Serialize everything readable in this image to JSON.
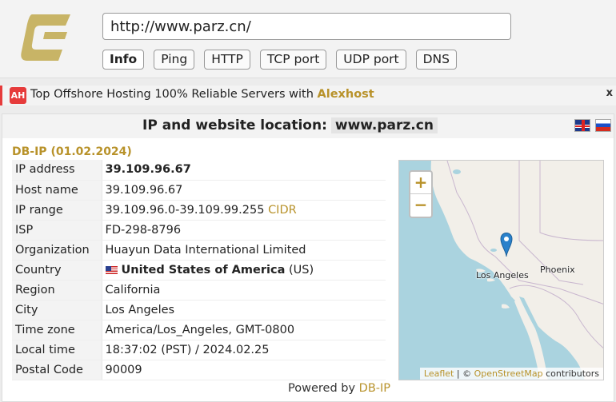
{
  "header": {
    "url_value": "http://www.parz.cn/",
    "tabs": [
      "Info",
      "Ping",
      "HTTP",
      "TCP port",
      "UDP port",
      "DNS"
    ],
    "active_tab": "Info",
    "logo_color": "#c8b466"
  },
  "ad": {
    "icon_text": "AH",
    "text": "Top Offshore Hosting 100% Reliable Servers with ",
    "brand": "Alexhost",
    "close": "x"
  },
  "panel": {
    "title": "IP and website location:",
    "domain": "www.parz.cn",
    "source": "DB-IP (01.02.2024)",
    "rows": {
      "ip_address": {
        "label": "IP address",
        "value": "39.109.96.67"
      },
      "host_name": {
        "label": "Host name",
        "value": "39.109.96.67"
      },
      "ip_range": {
        "label": "IP range",
        "value": "39.109.96.0-39.109.99.255",
        "link": "CIDR"
      },
      "isp": {
        "label": "ISP",
        "value": "FD-298-8796"
      },
      "organization": {
        "label": "Organization",
        "value": "Huayun Data International Limited"
      },
      "country": {
        "label": "Country",
        "value": "United States of America",
        "code": "(US)"
      },
      "region": {
        "label": "Region",
        "value": "California"
      },
      "city": {
        "label": "City",
        "value": "Los Angeles"
      },
      "time_zone": {
        "label": "Time zone",
        "value": "America/Los_Angeles, GMT-0800"
      },
      "local_time": {
        "label": "Local time",
        "value": "18:37:02 (PST) / 2024.02.25"
      },
      "postal_code": {
        "label": "Postal Code",
        "value": "90009"
      }
    },
    "powered_text": "Powered by ",
    "powered_link": "DB-IP"
  },
  "map": {
    "zoom_in": "+",
    "zoom_out": "−",
    "labels": {
      "la": "Los Angeles",
      "phoenix": "Phoenix"
    },
    "attribution": {
      "leaflet": "Leaflet",
      "sep": " | © ",
      "osm": "OpenStreetMap",
      "tail": " contributors"
    }
  }
}
